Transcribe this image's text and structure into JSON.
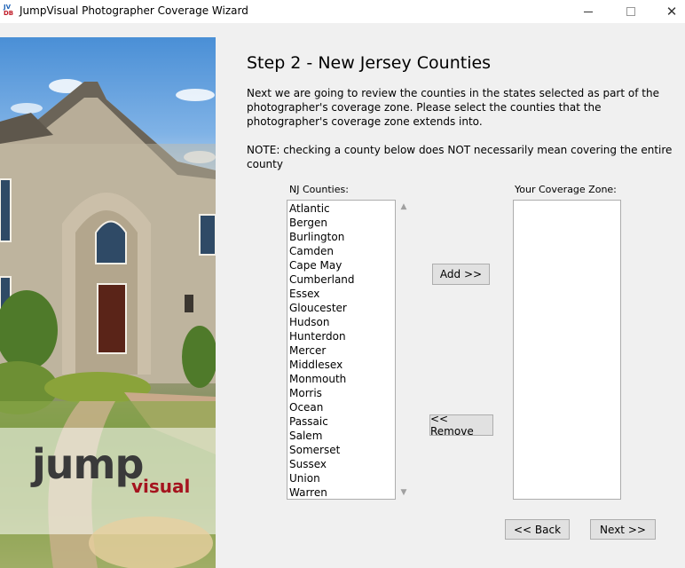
{
  "window": {
    "title": "JumpVisual Photographer Coverage Wizard",
    "icon_top": "JV",
    "icon_bottom": "DB",
    "minimize_icon": "minimize-icon",
    "maximize_icon": "maximize-icon",
    "close_symbol": "✕"
  },
  "logo": {
    "jump": "jump",
    "visual": "visual"
  },
  "step": {
    "title": "Step 2 - New Jersey Counties",
    "intro": "Next we are going to review the counties in the states selected as part of the photographer's coverage zone. Please select the counties that the photographer's coverage zone extends into.",
    "note": "NOTE: checking a county below does NOT necessarily mean covering the entire county"
  },
  "lists": {
    "nj_label": "NJ Counties:",
    "zone_label": "Your Coverage Zone:",
    "nj_counties": [
      "Atlantic",
      "Bergen",
      "Burlington",
      "Camden",
      "Cape May",
      "Cumberland",
      "Essex",
      "Gloucester",
      "Hudson",
      "Hunterdon",
      "Mercer",
      "Middlesex",
      "Monmouth",
      "Morris",
      "Ocean",
      "Passaic",
      "Salem",
      "Somerset",
      "Sussex",
      "Union",
      "Warren"
    ],
    "coverage_zone": []
  },
  "buttons": {
    "add": "Add >>",
    "remove": "<< Remove",
    "back": "<< Back",
    "next": "Next >>"
  },
  "scroll": {
    "up": "▲",
    "down": "▼"
  },
  "colors": {
    "window_bg": "#f0f0f0",
    "logo_dark": "#3a3a3a",
    "logo_red": "#a5141e"
  }
}
